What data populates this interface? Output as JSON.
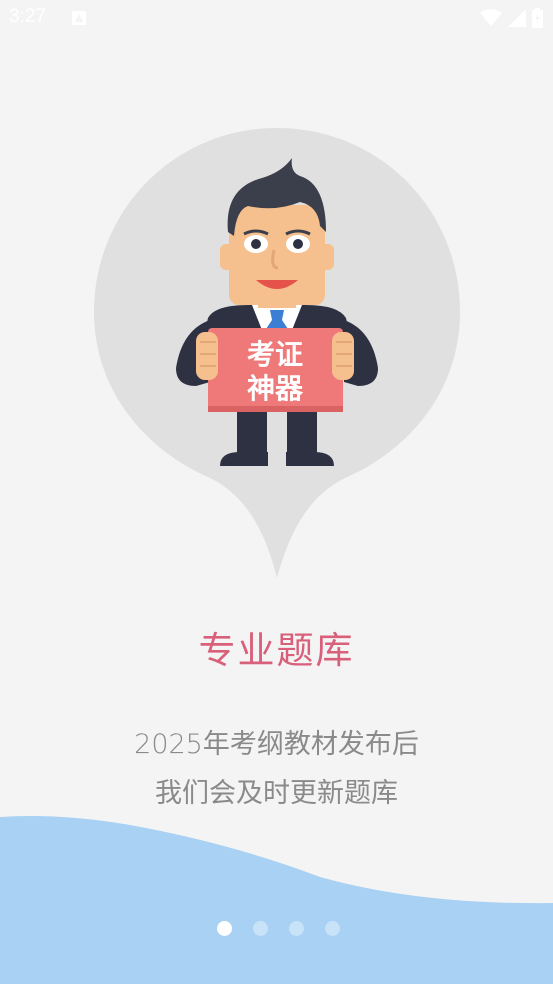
{
  "status_bar": {
    "time": "3:27"
  },
  "illustration": {
    "sign_line1": "考证",
    "sign_line2": "神器"
  },
  "slide": {
    "title": "专业题库",
    "description_line1": "2025年考纲教材发布后",
    "description_line2": "我们会及时更新题库"
  },
  "pager": {
    "total": 4,
    "active_index": 0
  },
  "colors": {
    "title": "#d9607a",
    "wave": "#a8d1f3",
    "background": "#f4f4f4",
    "bubble": "#e0e0e0",
    "sign": "#ef7878"
  }
}
